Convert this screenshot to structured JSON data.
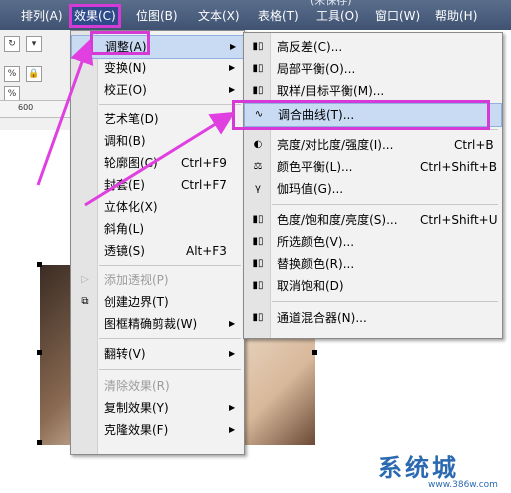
{
  "menubar": {
    "title_fragment": "(未保存)",
    "items": [
      "排列(A)",
      "效果(C)",
      "位图(B)",
      "文本(X)",
      "表格(T)",
      "工具(O)",
      "窗口(W)",
      "帮助(H)"
    ]
  },
  "toolbar": {
    "ruler_value": "600"
  },
  "effects_menu": {
    "items": [
      {
        "label": "调整(A)"
      },
      {
        "label": "变换(N)"
      },
      {
        "label": "校正(O)"
      },
      {
        "label": "艺术笔(D)"
      },
      {
        "label": "调和(B)"
      },
      {
        "label": "轮廓图(C)",
        "shortcut": "Ctrl+F9"
      },
      {
        "label": "封套(E)",
        "shortcut": "Ctrl+F7"
      },
      {
        "label": "立体化(X)"
      },
      {
        "label": "斜角(L)"
      },
      {
        "label": "透镜(S)",
        "shortcut": "Alt+F3"
      },
      {
        "label": "添加透视(P)"
      },
      {
        "label": "创建边界(T)"
      },
      {
        "label": "图框精确剪裁(W)"
      },
      {
        "label": "翻转(V)"
      },
      {
        "label": "清除效果(R)"
      },
      {
        "label": "复制效果(Y)"
      },
      {
        "label": "克隆效果(F)"
      }
    ]
  },
  "adjust_menu": {
    "items": [
      {
        "label": "高反差(C)..."
      },
      {
        "label": "局部平衡(O)..."
      },
      {
        "label": "取样/目标平衡(M)..."
      },
      {
        "label": "调合曲线(T)..."
      },
      {
        "label": "亮度/对比度/强度(I)...",
        "shortcut": "Ctrl+B"
      },
      {
        "label": "颜色平衡(L)...",
        "shortcut": "Ctrl+Shift+B"
      },
      {
        "label": "伽玛值(G)..."
      },
      {
        "label": "色度/饱和度/亮度(S)...",
        "shortcut": "Ctrl+Shift+U"
      },
      {
        "label": "所选颜色(V)..."
      },
      {
        "label": "替换颜色(R)..."
      },
      {
        "label": "取消饱和(D)"
      },
      {
        "label": "通道混合器(N)..."
      }
    ]
  },
  "watermark": {
    "text": "系统城",
    "url": "www.386w.com"
  },
  "colors": {
    "accent": "#d63ad6",
    "menubar": "#4a5d7e",
    "highlight": "#c9daf3"
  }
}
